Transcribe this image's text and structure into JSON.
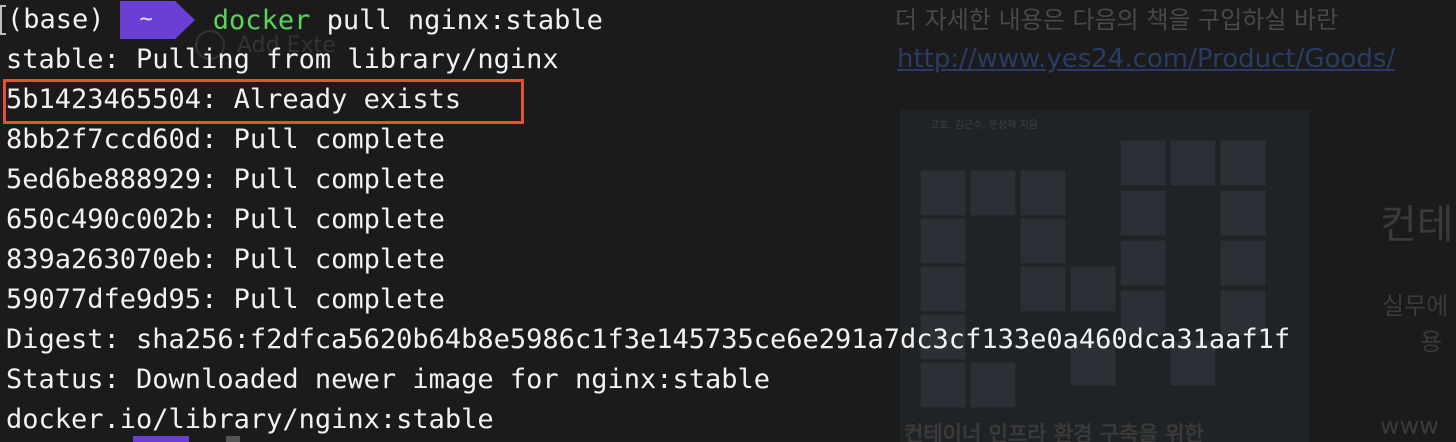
{
  "background": {
    "top_text": "더 자세한 내용은 다음의 책을 구입하실 바란",
    "link": "http://www.yes24.com/Product/Goods/",
    "extension_label": "Add Exte",
    "book_header": "고호, 김근수, 문성재 지음",
    "book_title": "컨테이너 인프라 환경 구축을 위한",
    "heading": "컨테",
    "sub1": "실무에",
    "sub2": "용",
    "www": "www"
  },
  "terminal": {
    "prompt": {
      "env": "(base)",
      "dir": "~",
      "command": "docker",
      "args": " pull nginx:stable"
    },
    "lines": [
      "stable: Pulling from library/nginx",
      "5b1423465504: Already exists",
      "8bb2f7ccd60d: Pull complete",
      "5ed6be888929: Pull complete",
      "650c490c002b: Pull complete",
      "839a263070eb: Pull complete",
      "59077dfe9d95: Pull complete",
      "Digest: sha256:f2dfca5620b64b8e5986c1f3e145735ce6e291a7dc3cf133e0a460dca31aaf1f",
      "Status: Downloaded newer image for nginx:stable",
      "docker.io/library/nginx:stable"
    ]
  },
  "colors": {
    "terminal_bg": "#1b1b1b",
    "prompt_segment": "#6a3fd4",
    "command_green": "#5ad35a",
    "highlight_red": "#e4532f",
    "text": "#f2f2f2"
  }
}
